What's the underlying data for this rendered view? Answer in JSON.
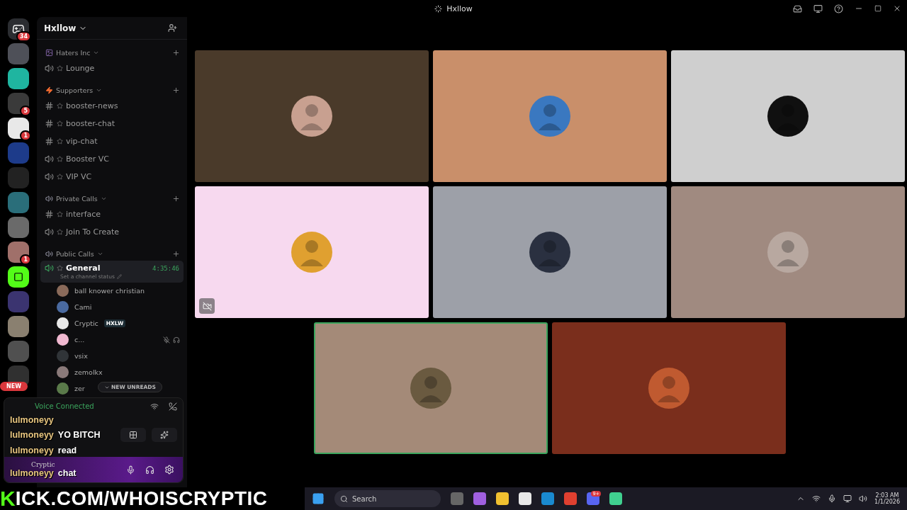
{
  "window": {
    "title": "Hxllow"
  },
  "servers": [
    {
      "color": "#2b2d31",
      "badge": "34",
      "kind": "home"
    },
    {
      "color": "#4e5058",
      "kind": "icon"
    },
    {
      "color": "#1fb5a0",
      "kind": "icon"
    },
    {
      "color": "#3a3a3a",
      "badge": "5",
      "kind": "icon"
    },
    {
      "color": "#e8e8e8",
      "badge": "1",
      "kind": "icon"
    },
    {
      "color": "#1d3b8a",
      "kind": "icon"
    },
    {
      "color": "#222222",
      "kind": "icon"
    },
    {
      "color": "#2a6e7a",
      "kind": "icon"
    },
    {
      "color": "#6a6a6a",
      "kind": "icon"
    },
    {
      "color": "#a0706a",
      "badge": "1",
      "kind": "icon"
    },
    {
      "color": "#53fc18",
      "kind": "kick"
    },
    {
      "color": "#3b3470",
      "kind": "icon"
    },
    {
      "color": "#8a8070",
      "kind": "icon"
    },
    {
      "color": "#505050",
      "kind": "icon"
    },
    {
      "color": "#303030",
      "badge": "NEW",
      "kind": "icon"
    }
  ],
  "server": {
    "name": "Hxllow"
  },
  "categories": [
    {
      "name": "Haters Inc",
      "kind": "image",
      "channels": [
        {
          "name": "Lounge",
          "kind": "voice",
          "selected": false
        }
      ]
    },
    {
      "name": "Supporters",
      "kind": "bolt",
      "channels": [
        {
          "name": "booster-news",
          "kind": "text",
          "selected": false
        },
        {
          "name": "booster-chat",
          "kind": "text",
          "selected": false
        },
        {
          "name": "vip-chat",
          "kind": "text",
          "selected": false
        },
        {
          "name": "Booster VC",
          "kind": "voice",
          "selected": false
        },
        {
          "name": "VIP VC",
          "kind": "voice",
          "selected": false
        }
      ]
    },
    {
      "name": "Private Calls",
      "kind": "speaker",
      "channels": [
        {
          "name": "interface",
          "kind": "text",
          "selected": false
        },
        {
          "name": "Join To Create",
          "kind": "voice",
          "selected": false
        }
      ]
    },
    {
      "name": "Public Calls",
      "kind": "speaker",
      "channels": [
        {
          "name": "General",
          "kind": "voice",
          "selected": true,
          "time": "4:35:46",
          "status": "Set a channel status"
        }
      ]
    }
  ],
  "members": [
    {
      "name": "ball knower christian",
      "color": "#8a6a5a",
      "muted": false
    },
    {
      "name": "Cami",
      "color": "#4a6aa0",
      "muted": false
    },
    {
      "name": "Cryptic",
      "color": "#e8e8e8",
      "tag": "HXLW",
      "muted": false
    },
    {
      "name": "c...",
      "color": "#f0b8d0",
      "muted": true
    },
    {
      "name": "vsix",
      "color": "#303438",
      "muted": false
    },
    {
      "name": "zemolkx",
      "color": "#8a7a7a",
      "muted": false
    },
    {
      "name": "zer",
      "color": "#5a7a4a",
      "muted": false
    }
  ],
  "new_unreads": "NEW UNREADS",
  "voice": {
    "status": "Voice Connected"
  },
  "chat_overlay": [
    {
      "user": "lulmoneyy"
    },
    {
      "user": "lulmoneyy",
      "message": "YO BITCH"
    },
    {
      "user": "lulmoneyy",
      "message": "read"
    },
    {
      "user": "lulmoneyy",
      "message": "chat"
    }
  ],
  "user_panel": {
    "name": "Cryptic"
  },
  "tiles": [
    {
      "color": "#4a3a2a",
      "selected": false,
      "stream_hidden": false
    },
    {
      "color": "#c98f6a",
      "selected": false,
      "stream_hidden": false
    },
    {
      "color": "#cfcfcf",
      "selected": false,
      "stream_hidden": false
    },
    {
      "color": "#f7d9ef",
      "selected": false,
      "stream_hidden": true
    },
    {
      "color": "#9da0a8",
      "selected": false,
      "stream_hidden": false
    },
    {
      "color": "#a08a80",
      "selected": false,
      "stream_hidden": false
    },
    {
      "color": "#a48a78",
      "selected": true,
      "stream_hidden": false
    },
    {
      "color": "#7a2e1c",
      "selected": false,
      "stream_hidden": false
    }
  ],
  "banner": {
    "logo": "K",
    "text": "ICK.COM/WHOISCRYPTIC"
  },
  "taskbar": {
    "search": "Search",
    "discord_badge": "9+",
    "time": "2:03 AM",
    "date": "1/1/2026"
  }
}
